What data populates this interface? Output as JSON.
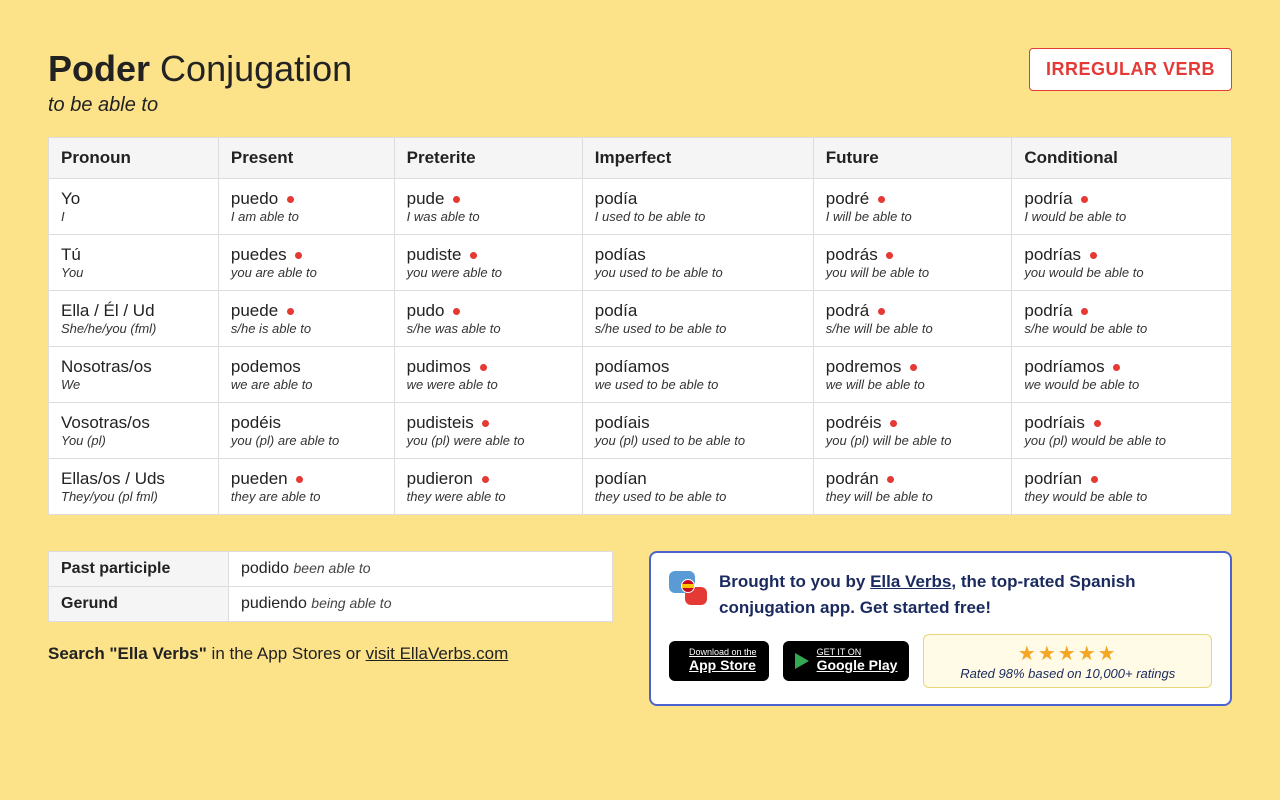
{
  "header": {
    "verb": "Poder",
    "title_rest": "Conjugation",
    "translation": "to be able to",
    "badge": "IRREGULAR VERB"
  },
  "columns": [
    "Pronoun",
    "Present",
    "Preterite",
    "Imperfect",
    "Future",
    "Conditional"
  ],
  "rows": [
    {
      "pronoun": "Yo",
      "pronoun_sub": "I",
      "cells": [
        {
          "form": "puedo",
          "sub": "I am able to",
          "irr": true
        },
        {
          "form": "pude",
          "sub": "I was able to",
          "irr": true
        },
        {
          "form": "podía",
          "sub": "I used to be able to",
          "irr": false
        },
        {
          "form": "podré",
          "sub": "I will be able to",
          "irr": true
        },
        {
          "form": "podría",
          "sub": "I would be able to",
          "irr": true
        }
      ]
    },
    {
      "pronoun": "Tú",
      "pronoun_sub": "You",
      "cells": [
        {
          "form": "puedes",
          "sub": "you are able to",
          "irr": true
        },
        {
          "form": "pudiste",
          "sub": "you were able to",
          "irr": true
        },
        {
          "form": "podías",
          "sub": "you used to be able to",
          "irr": false
        },
        {
          "form": "podrás",
          "sub": "you will be able to",
          "irr": true
        },
        {
          "form": "podrías",
          "sub": "you would be able to",
          "irr": true
        }
      ]
    },
    {
      "pronoun": "Ella / Él / Ud",
      "pronoun_sub": "She/he/you (fml)",
      "cells": [
        {
          "form": "puede",
          "sub": "s/he is able to",
          "irr": true
        },
        {
          "form": "pudo",
          "sub": "s/he was able to",
          "irr": true
        },
        {
          "form": "podía",
          "sub": "s/he used to be able to",
          "irr": false
        },
        {
          "form": "podrá",
          "sub": "s/he will be able to",
          "irr": true
        },
        {
          "form": "podría",
          "sub": "s/he would be able to",
          "irr": true
        }
      ]
    },
    {
      "pronoun": "Nosotras/os",
      "pronoun_sub": "We",
      "cells": [
        {
          "form": "podemos",
          "sub": "we are able to",
          "irr": false
        },
        {
          "form": "pudimos",
          "sub": "we were able to",
          "irr": true
        },
        {
          "form": "podíamos",
          "sub": "we used to be able to",
          "irr": false
        },
        {
          "form": "podremos",
          "sub": "we will be able to",
          "irr": true
        },
        {
          "form": "podríamos",
          "sub": "we would be able to",
          "irr": true
        }
      ]
    },
    {
      "pronoun": "Vosotras/os",
      "pronoun_sub": "You (pl)",
      "cells": [
        {
          "form": "podéis",
          "sub": "you (pl) are able to",
          "irr": false
        },
        {
          "form": "pudisteis",
          "sub": "you (pl) were able to",
          "irr": true
        },
        {
          "form": "podíais",
          "sub": "you (pl) used to be able to",
          "irr": false
        },
        {
          "form": "podréis",
          "sub": "you (pl) will be able to",
          "irr": true
        },
        {
          "form": "podríais",
          "sub": "you (pl) would be able to",
          "irr": true
        }
      ]
    },
    {
      "pronoun": "Ellas/os / Uds",
      "pronoun_sub": "They/you (pl fml)",
      "cells": [
        {
          "form": "pueden",
          "sub": "they are able to",
          "irr": true
        },
        {
          "form": "pudieron",
          "sub": "they were able to",
          "irr": true
        },
        {
          "form": "podían",
          "sub": "they used to be able to",
          "irr": false
        },
        {
          "form": "podrán",
          "sub": "they will be able to",
          "irr": true
        },
        {
          "form": "podrían",
          "sub": "they would be able to",
          "irr": true
        }
      ]
    }
  ],
  "participles": [
    {
      "label": "Past participle",
      "form": "podido",
      "sub": "been able to"
    },
    {
      "label": "Gerund",
      "form": "pudiendo",
      "sub": "being able to"
    }
  ],
  "search_line": {
    "prefix": "Search \"Ella Verbs\"",
    "mid": " in the App Stores or ",
    "link": "visit EllaVerbs.com"
  },
  "promo": {
    "text_prefix": "Brought to you by ",
    "link": "Ella Verbs",
    "text_suffix": ", the top-rated Spanish conjugation app. Get started free!",
    "appstore_l1": "Download on the",
    "appstore_l2": "App Store",
    "gplay_l1": "GET IT ON",
    "gplay_l2": "Google Play",
    "stars": "★★★★★",
    "rating_text": "Rated 98% based on 10,000+ ratings"
  }
}
